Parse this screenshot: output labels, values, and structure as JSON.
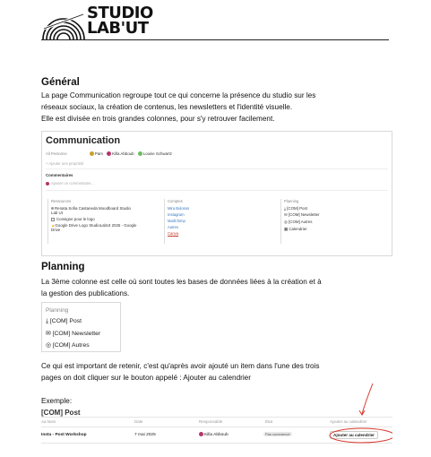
{
  "logo": {
    "line1": "STUDIO",
    "line2": "LAB'UT"
  },
  "general": {
    "heading": "Général",
    "line1": "La page Communication regroupe tout ce qui concerne la présence du studio sur les",
    "line2": "réseaux sociaux, la création de contenus, les newsletters et l'identité visuelle.",
    "line3": "Elle est divisée en trois grandes colonnes, pour s'y retrouver facilement."
  },
  "comm_shot": {
    "title": "Communication",
    "persons_label": "All Personne",
    "persons": [
      {
        "name": "Pam",
        "color": "#c9a227"
      },
      {
        "name": "Killa Abboub",
        "color": "#b8336a"
      },
      {
        "name": "Louise Schwartz",
        "color": "#6dbb63"
      }
    ],
    "add_property": "+ Ajouter une propriété",
    "comments_label": "Commentaires",
    "add_comment": "Ajouter un commentaire...",
    "col1": {
      "title": "Ressources",
      "items": [
        "Renata Sofia Castaneda Moodboard Studio",
        "Lab Ut",
        "Consigne pour le logo",
        "Google Drive Logo StudioLabUt 2025 - Google",
        "Drive"
      ]
    },
    "col2": {
      "title": "Comptes",
      "items": [
        "Mira Bulosos",
        "Instagram",
        "MailChimp",
        "Autres",
        "Canva"
      ]
    },
    "col3": {
      "title": "Planning",
      "items": [
        "[COM] Post",
        "[COM] Newsletter",
        "[COM] Autres",
        "Calendrier"
      ]
    }
  },
  "planning": {
    "heading": "Planning",
    "line1": "La 3ème colonne est celle où sont toutes les bases de données liées à la création et à",
    "line2": "la gestion des publications."
  },
  "planning_shot": {
    "title": "Planning",
    "items": [
      "[COM] Post",
      "[COM] Newsletter",
      "[COM] Autres"
    ]
  },
  "important": {
    "line1": "Ce qui est important de retenir, c'est qu'après avoir ajouté un item dans l'une des trois",
    "line2": "pages on doit cliquer sur le bouton appelé : Ajouter au calendrier"
  },
  "example_label": "Exemple:",
  "post_shot": {
    "title": "[COM] Post",
    "headers": [
      "Aa Nom",
      "Date",
      "Responsable",
      "État",
      "Ajouter au calendrier"
    ],
    "row": {
      "name": "Insta - Post Workshop",
      "date": "7 mai 2025",
      "responsable": "Killa Abboub",
      "etat": "Pas commencé",
      "button": "Ajouter au calendrier"
    },
    "accent": "#d9372b"
  }
}
